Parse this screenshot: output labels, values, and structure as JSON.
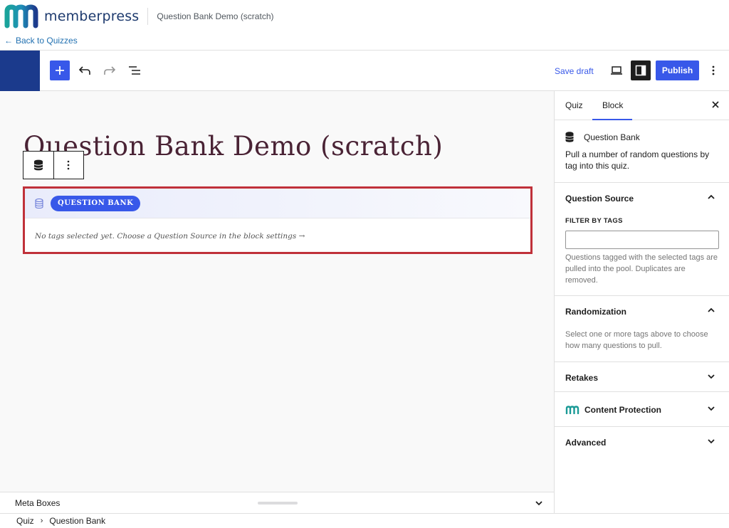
{
  "topbar": {
    "brand": "memberpress",
    "page_title": "Question Bank Demo (scratch)"
  },
  "back_link": {
    "arrow": "←",
    "label": "Back to Quizzes"
  },
  "toolbar": {
    "add_icon": "plus-icon",
    "undo_icon": "undo-icon",
    "redo_icon": "redo-icon",
    "list_view_icon": "list-view-icon",
    "save_draft": "Save draft",
    "view_icon": "laptop-icon",
    "settings_icon": "sidebar-toggle-icon",
    "publish": "Publish",
    "more_icon": "more-vertical-icon"
  },
  "canvas": {
    "title": "Question Bank Demo (scratch)",
    "block": {
      "badge": "QUESTION BANK",
      "empty_message": "No tags selected yet. Choose a Question Source in the block settings →"
    }
  },
  "meta_boxes": {
    "label": "Meta Boxes"
  },
  "breadcrumb": {
    "items": [
      "Quiz",
      "Question Bank"
    ],
    "separator": "›"
  },
  "sidebar": {
    "tabs": [
      {
        "label": "Quiz",
        "active": false
      },
      {
        "label": "Block",
        "active": true
      }
    ],
    "block_card": {
      "title": "Question Bank",
      "description": "Pull a number of random questions by tag into this quiz."
    },
    "panels": {
      "question_source": {
        "title": "Question Source",
        "expanded": true,
        "filter_label": "FILTER BY TAGS",
        "filter_value": "",
        "help": "Questions tagged with the selected tags are pulled into the pool. Duplicates are removed."
      },
      "randomization": {
        "title": "Randomization",
        "expanded": true,
        "help": "Select one or more tags above to choose how many questions to pull."
      },
      "retakes": {
        "title": "Retakes",
        "expanded": false
      },
      "content_protection": {
        "title": "Content Protection",
        "expanded": false
      },
      "advanced": {
        "title": "Advanced",
        "expanded": false
      }
    }
  },
  "colors": {
    "accent": "#3858e9",
    "brand_dark": "#1b3a8c",
    "highlight_border": "#c0313a",
    "title_color": "#4a2335"
  }
}
